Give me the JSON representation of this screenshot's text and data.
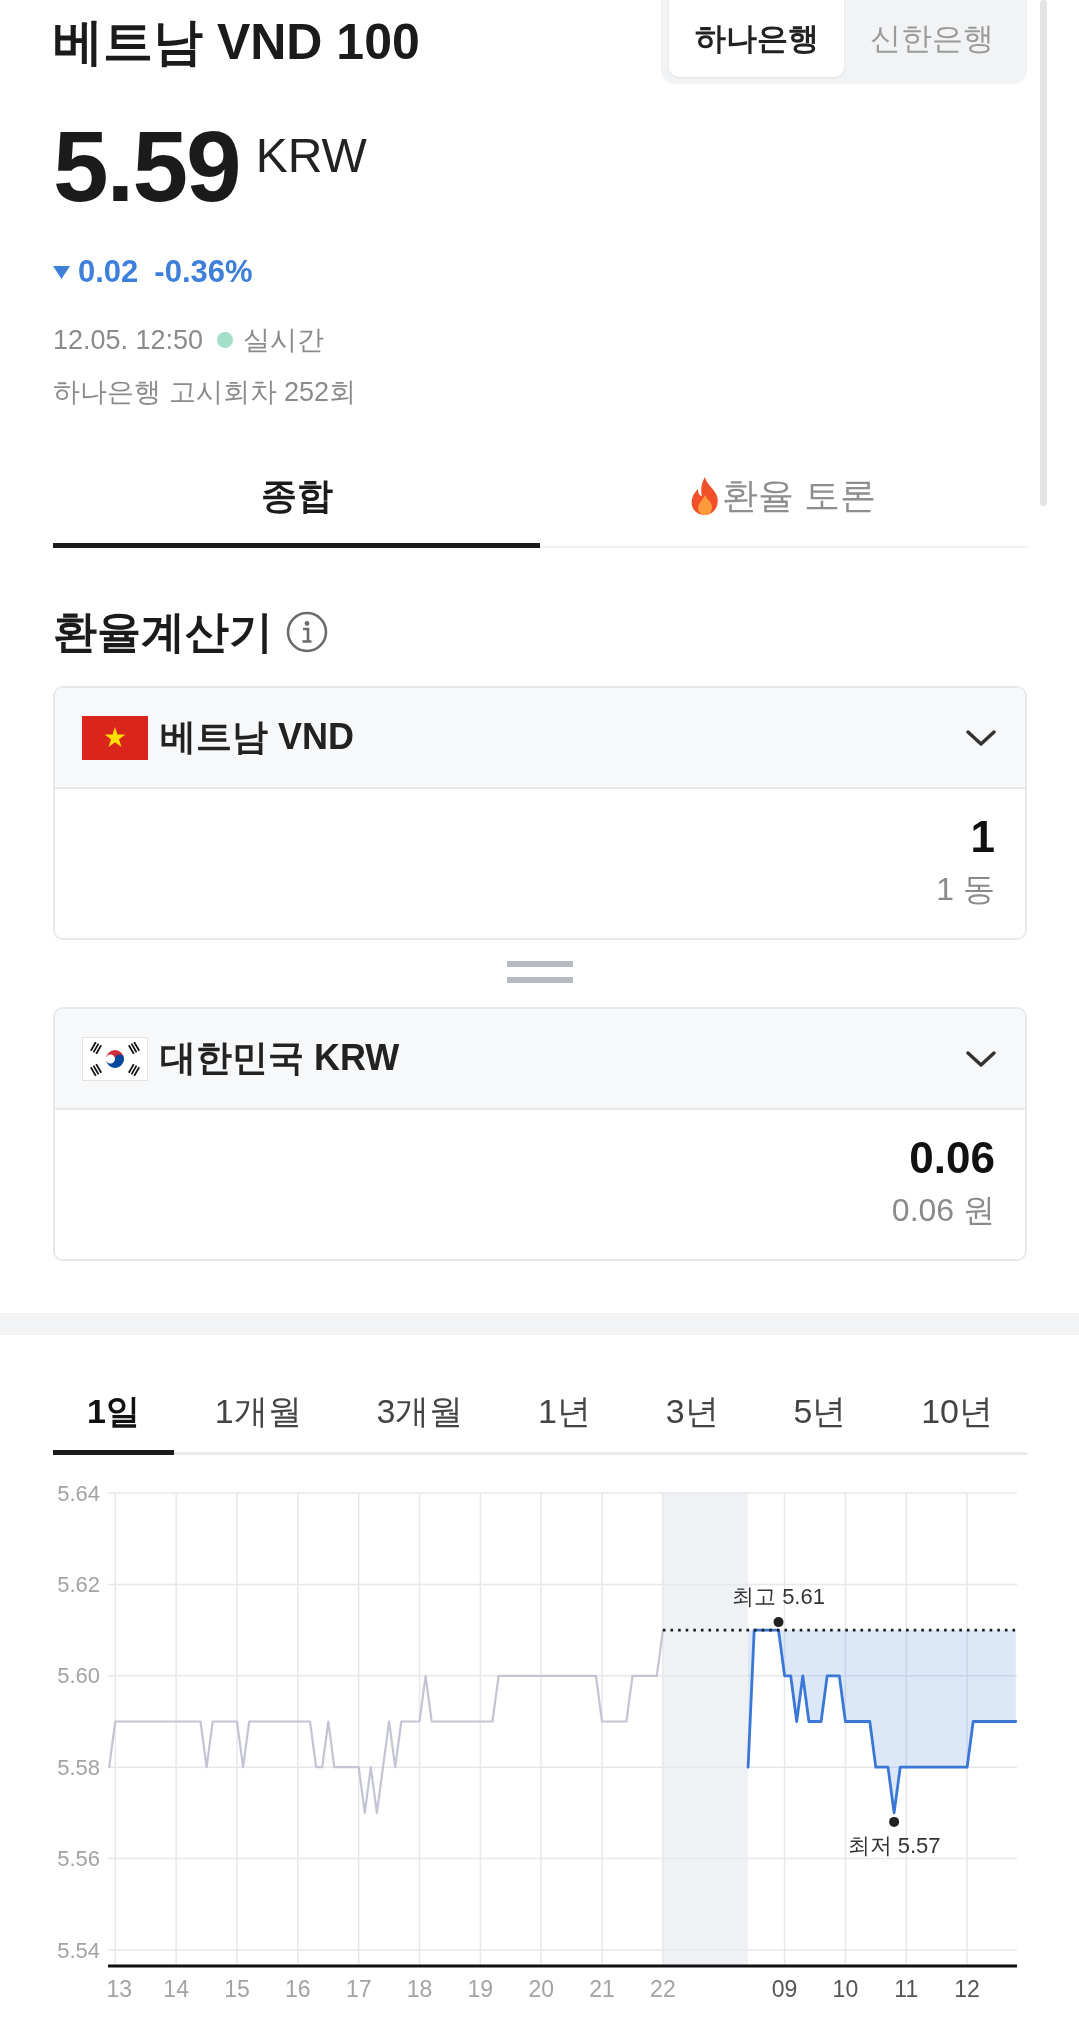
{
  "header": {
    "title": "베트남 VND 100",
    "bank_tabs": [
      {
        "label": "하나은행",
        "selected": true
      },
      {
        "label": "신한은행",
        "selected": false
      }
    ]
  },
  "quote": {
    "price": "5.59",
    "unit": "KRW",
    "falling": true,
    "change": "0.02",
    "change_percent": "-0.36%",
    "timestamp": "12.05. 12:50",
    "live": true,
    "live_label": "실시간",
    "notice": "하나은행 고시회차 252회"
  },
  "tabs": [
    {
      "label": "종합",
      "selected": true,
      "hot": false
    },
    {
      "label": "환율 토론",
      "selected": false,
      "hot": true
    }
  ],
  "calculator": {
    "title": "환율계산기",
    "currencies": [
      {
        "kind": "vietnam",
        "name": "베트남 VND",
        "amount": "1",
        "amount_text": "1 동"
      },
      {
        "kind": "korea",
        "name": "대한민국 KRW",
        "amount": "0.06",
        "amount_text": "0.06 원"
      }
    ]
  },
  "chart": {
    "periods": [
      {
        "label": "1일",
        "selected": true
      },
      {
        "label": "1개월",
        "selected": false
      },
      {
        "label": "3개월",
        "selected": false
      },
      {
        "label": "1년",
        "selected": false
      },
      {
        "label": "3년",
        "selected": false
      },
      {
        "label": "5년",
        "selected": false
      },
      {
        "label": "10년",
        "selected": false
      }
    ],
    "chart_data": {
      "type": "line",
      "grid": true,
      "categories": [
        null,
        "13",
        null,
        null,
        null,
        null,
        null,
        null,
        null,
        null,
        null,
        "14",
        null,
        null,
        null,
        null,
        null,
        null,
        null,
        null,
        null,
        "15",
        null,
        null,
        null,
        null,
        null,
        null,
        null,
        null,
        null,
        "16",
        null,
        null,
        null,
        null,
        null,
        null,
        null,
        null,
        null,
        "17",
        null,
        null,
        null,
        null,
        null,
        null,
        null,
        null,
        null,
        "18",
        null,
        null,
        null,
        null,
        null,
        null,
        null,
        null,
        null,
        "19",
        null,
        null,
        null,
        null,
        null,
        null,
        null,
        null,
        null,
        "20",
        null,
        null,
        null,
        null,
        null,
        null,
        null,
        null,
        null,
        "21",
        null,
        null,
        null,
        null,
        null,
        null,
        null,
        null,
        null,
        "22",
        null,
        null,
        null,
        null,
        null,
        null,
        null,
        null,
        null,
        null,
        null,
        null,
        null,
        null,
        null,
        null,
        null,
        null,
        null,
        "09",
        null,
        null,
        null,
        null,
        null,
        null,
        null,
        null,
        null,
        "10",
        null,
        null,
        null,
        null,
        null,
        null,
        null,
        null,
        null,
        "11",
        null,
        null,
        null,
        null,
        null,
        null,
        null,
        null,
        null,
        "12",
        null,
        null,
        null,
        null,
        null,
        null,
        null,
        null
      ],
      "series": [
        {
          "color": "#c3c5d4",
          "values": [
            5.58,
            5.59,
            5.59,
            5.59,
            5.59,
            5.59,
            5.59,
            5.59,
            5.59,
            5.59,
            5.59,
            5.59,
            5.59,
            5.59,
            5.59,
            5.59,
            5.58,
            5.59,
            5.59,
            5.59,
            5.59,
            5.59,
            5.58,
            5.59,
            5.59,
            5.59,
            5.59,
            5.59,
            5.59,
            5.59,
            5.59,
            5.59,
            5.59,
            5.59,
            5.58,
            5.58,
            5.59,
            5.58,
            5.58,
            5.58,
            5.58,
            5.58,
            5.57,
            5.58,
            5.57,
            5.58,
            5.59,
            5.58,
            5.59,
            5.59,
            5.59,
            5.59,
            5.6,
            5.59,
            5.59,
            5.59,
            5.59,
            5.59,
            5.59,
            5.59,
            5.59,
            5.59,
            5.59,
            5.59,
            5.6,
            5.6,
            5.6,
            5.6,
            5.6,
            5.6,
            5.6,
            5.6,
            5.6,
            5.6,
            5.6,
            5.6,
            5.6,
            5.6,
            5.6,
            5.6,
            5.6,
            5.59,
            5.59,
            5.59,
            5.59,
            5.59,
            5.6,
            5.6,
            5.6,
            5.6,
            5.6,
            5.61,
            null,
            null,
            null,
            null,
            null,
            null,
            null,
            null,
            null,
            null,
            null,
            null,
            null,
            null,
            null,
            null,
            null,
            null,
            null,
            null,
            null,
            null,
            null,
            null,
            null,
            null,
            null,
            null,
            null,
            null,
            null,
            null,
            null,
            null,
            null,
            null,
            null,
            null,
            null,
            null,
            null,
            null,
            null,
            null,
            null,
            null,
            null,
            null,
            null,
            null,
            null,
            null,
            null,
            null,
            null,
            null,
            null,
            null
          ]
        },
        {
          "color": "#3b78d6",
          "values": [
            null,
            null,
            null,
            null,
            null,
            null,
            null,
            null,
            null,
            null,
            null,
            null,
            null,
            null,
            null,
            null,
            null,
            null,
            null,
            null,
            null,
            null,
            null,
            null,
            null,
            null,
            null,
            null,
            null,
            null,
            null,
            null,
            null,
            null,
            null,
            null,
            null,
            null,
            null,
            null,
            null,
            null,
            null,
            null,
            null,
            null,
            null,
            null,
            null,
            null,
            null,
            null,
            null,
            null,
            null,
            null,
            null,
            null,
            null,
            null,
            null,
            null,
            null,
            null,
            null,
            null,
            null,
            null,
            null,
            null,
            null,
            null,
            null,
            null,
            null,
            null,
            null,
            null,
            null,
            null,
            null,
            null,
            null,
            null,
            null,
            null,
            null,
            null,
            null,
            null,
            null,
            null,
            null,
            null,
            null,
            null,
            null,
            null,
            null,
            null,
            null,
            null,
            null,
            null,
            null,
            5.58,
            5.61,
            5.61,
            5.61,
            5.61,
            5.61,
            5.6,
            5.6,
            5.59,
            5.6,
            5.59,
            5.59,
            5.59,
            5.6,
            5.6,
            5.6,
            5.59,
            5.59,
            5.59,
            5.59,
            5.59,
            5.58,
            5.58,
            5.58,
            5.57,
            5.58,
            5.58,
            5.58,
            5.58,
            5.58,
            5.58,
            5.58,
            5.58,
            5.58,
            5.58,
            5.58,
            5.58,
            5.59,
            5.59,
            5.59,
            5.59,
            5.59,
            5.59,
            5.59,
            5.59
          ]
        }
      ],
      "ylim": [
        5.5365,
        5.64
      ],
      "yticks": [
        {
          "value": 5.54,
          "label": "5.54"
        },
        {
          "value": 5.56,
          "label": "5.56"
        },
        {
          "value": 5.58,
          "label": "5.58"
        },
        {
          "value": 5.6,
          "label": "5.60"
        },
        {
          "value": 5.62,
          "label": "5.62"
        },
        {
          "value": 5.64,
          "label": "5.64"
        }
      ],
      "ref_lines": [
        {
          "axis": "y",
          "value": 5.61
        }
      ],
      "annotations": [
        {
          "y": 5.61,
          "text": "최고 5.61"
        },
        {
          "y": 5.57,
          "text": "최저 5.57"
        }
      ]
    }
  }
}
